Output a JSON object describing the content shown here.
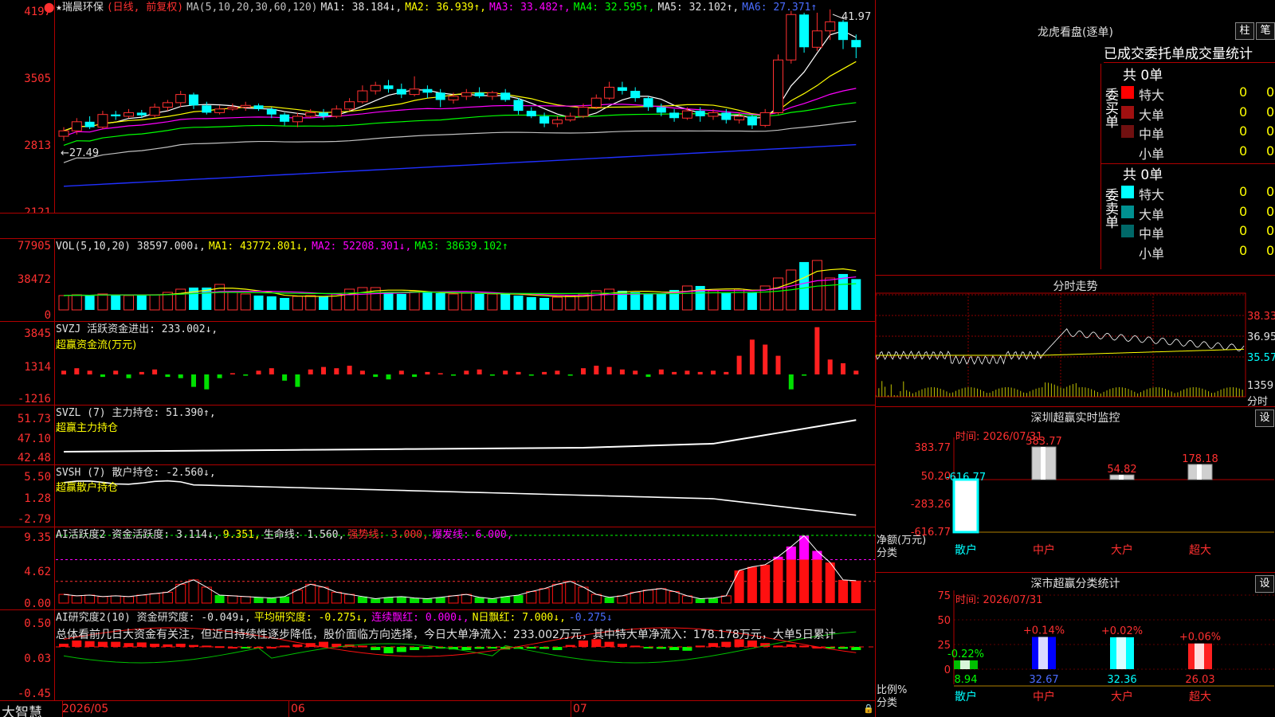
{
  "stock": {
    "name": "★瑞晨环保",
    "mode": "(日线, 前复权)",
    "ma_params": "MA(5,10,20,30,60,120)",
    "ma1": "MA1: 38.184↓,",
    "ma2": "MA2: 36.939↑,",
    "ma3": "MA3: 33.482↑,",
    "ma4": "MA4: 32.595↑,",
    "ma5": "MA5: 32.102↑,",
    "ma6": "MA6: 27.371↑",
    "high_label": "41.97",
    "low_label": "←27.49",
    "y_ticks": [
      "4197",
      "3505",
      "2813",
      "2121"
    ]
  },
  "vol": {
    "title": "VOL(5,10,20) 38597.000↓,",
    "ma1": "MA1: 43772.801↓,",
    "ma2": "MA2: 52208.301↓,",
    "ma3": "MA3: 38639.102↑",
    "y_ticks": [
      "77905",
      "38472",
      "0"
    ]
  },
  "svzj": {
    "title": "SVZJ  活跃资金进出: 233.002↓,",
    "subtitle": "超赢资金流(万元)",
    "y_ticks": [
      "3845",
      "1314",
      "-1216"
    ]
  },
  "svzl": {
    "title": "SVZL (7) 主力持仓: 51.390↑,",
    "subtitle": "超赢主力持仓",
    "y_ticks": [
      "51.73",
      "47.10",
      "42.48"
    ]
  },
  "svsh": {
    "title": "SVSH (7) 散户持仓: -2.560↓,",
    "subtitle": "超赢散户持仓",
    "y_ticks": [
      "5.50",
      "1.28",
      "-2.79"
    ]
  },
  "ai_active": {
    "title": "AI活跃度2 资金活跃度: 3.114↓,",
    "v2": "9.351,",
    "v3": "生命线: 1.560,",
    "v4": "强势线: 3.000,",
    "v5": "爆发线: 6.000,",
    "y_ticks": [
      "9.35",
      "4.62",
      "0.00"
    ]
  },
  "ai_research": {
    "title": "AI研究度2(10) 资金研究度: -0.049↓,",
    "v2": "平均研究度: -0.275↓,",
    "v3": "连续飘红: 0.000↓,",
    "v4": "N日飘红: 7.000↓,",
    "v5": "-0.275↓",
    "comment": "总体看前几日大资金有关注，但近日持续性逐步降低，股价面临方向选择，今日大单净流入：233.002万元，其中特大单净流入：178.178万元，大单5日累计",
    "y_ticks": [
      "0.50",
      "0.03",
      "-0.45"
    ]
  },
  "bottom": {
    "brand": "大智慧",
    "dates": [
      "2026/05",
      "06",
      "07"
    ]
  },
  "lhb": {
    "title": "龙虎看盘(逐单)",
    "btn1": "柱",
    "btn2": "笔",
    "tabs": "已成交委托单成交量统计",
    "buy_label": "委买单",
    "sell_label": "委卖单",
    "buy_total": "共 0单",
    "sell_total": "共 0单",
    "buy_rows": [
      {
        "name": "特大",
        "val": "0",
        "pct": "0%",
        "color": "#ff0000"
      },
      {
        "name": "大单",
        "val": "0",
        "pct": "0%",
        "color": "#a01010"
      },
      {
        "name": "中单",
        "val": "0",
        "pct": "0%",
        "color": "#701010"
      },
      {
        "name": "小单",
        "val": "0",
        "pct": "0%",
        "color": ""
      }
    ],
    "sell_rows": [
      {
        "name": "特大",
        "val": "0",
        "pct": "0%",
        "color": "#00ffff"
      },
      {
        "name": "大单",
        "val": "0",
        "pct": "0%",
        "color": "#009090"
      },
      {
        "name": "中单",
        "val": "0",
        "pct": "0%",
        "color": "#006868"
      },
      {
        "name": "小单",
        "val": "0",
        "pct": "0%",
        "color": ""
      }
    ]
  },
  "fenshi": {
    "title": "分时走势",
    "y_ticks": [
      "38.33",
      "36.95",
      "35.57",
      "1359"
    ],
    "label_fen": "分时"
  },
  "monitor": {
    "title": "深圳超赢实时监控",
    "btn": "设",
    "time": "时间: 2026/07/31",
    "y_ticks": [
      "383.77",
      "50.20",
      "-283.26",
      "-616.77"
    ],
    "ylabel1": "净额(万元)",
    "ylabel2": "分类",
    "bars": [
      {
        "cat": "散户",
        "value": -616.77,
        "label": "-616.77",
        "color": "#00ffff"
      },
      {
        "cat": "中户",
        "value": 383.77,
        "label": "383.77",
        "color": "#c0c0c0"
      },
      {
        "cat": "大户",
        "value": 54.82,
        "label": "54.82",
        "color": "#c0c0c0"
      },
      {
        "cat": "超大",
        "value": 178.18,
        "label": "178.18",
        "color": "#c0c0c0"
      }
    ]
  },
  "classify": {
    "title": "深市超赢分类统计",
    "btn": "设",
    "time": "时间: 2026/07/31",
    "y_ticks": [
      "75",
      "50",
      "25",
      "0"
    ],
    "ylabel1": "比例%",
    "ylabel2": "分类",
    "bars": [
      {
        "cat": "散户",
        "value": 8.94,
        "value_label": "8.94",
        "delta": "-0.22%",
        "color": "#00c000",
        "delta_color": "#00ff00",
        "val_color": "#00ff00"
      },
      {
        "cat": "中户",
        "value": 32.67,
        "value_label": "32.67",
        "delta": "+0.14%",
        "color": "#0000ff",
        "delta_color": "#ff3030",
        "val_color": "#4a6cff"
      },
      {
        "cat": "大户",
        "value": 32.36,
        "value_label": "32.36",
        "delta": "+0.02%",
        "color": "#00ffff",
        "delta_color": "#ff3030",
        "val_color": "#00ffff"
      },
      {
        "cat": "超大",
        "value": 26.03,
        "value_label": "26.03",
        "delta": "+0.06%",
        "color": "#ff2020",
        "delta_color": "#ff3030",
        "val_color": "#ff3030"
      }
    ]
  }
}
